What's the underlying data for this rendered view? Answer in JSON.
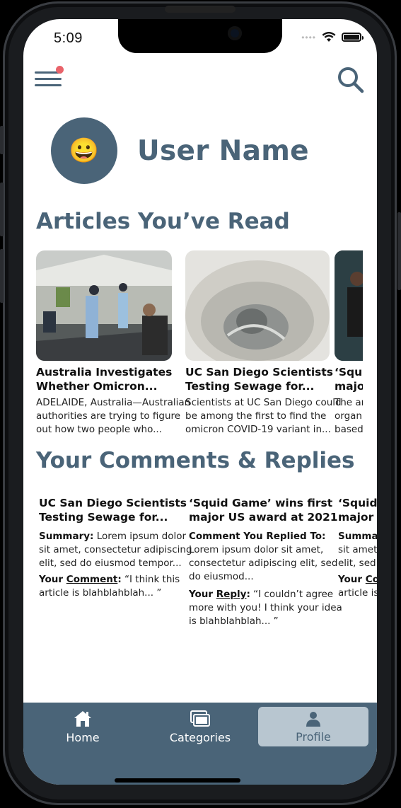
{
  "status": {
    "time": "5:09"
  },
  "profile": {
    "user_name": "User Name",
    "avatar_emoji": "😀"
  },
  "sections": {
    "articles_title": "Articles You’ve Read",
    "comments_title": "Your Comments & Replies"
  },
  "articles": [
    {
      "title1": "Australia Investigates",
      "title2": "Whether Omicron...",
      "s1": "ADELAIDE, Australia—Australian",
      "s2": "authorities are trying to figure",
      "s3": "out how two people who..."
    },
    {
      "title1": "UC San Diego Scientists",
      "title2": "Testing Sewage for...",
      "s1": "Scientists at UC San Diego could",
      "s2": "be among the first to find the",
      "s3": "omicron COVID-19 variant in..."
    },
    {
      "title1": "‘Squid Game’",
      "title2": "major US award",
      "s1": "The article on",
      "s2": "organization",
      "s3": "based..."
    }
  ],
  "comments": [
    {
      "title1": "UC San Diego Scientists",
      "title2": "Testing Sewage for...",
      "summary_label": "Summary:",
      "summary_l1": " Lorem ipsum dolor",
      "summary_l2": "sit amet, consectetur adipiscing",
      "summary_l3": "elit, sed do eiusmod tempor...",
      "your_label": "Your ",
      "your_ul": "Comment",
      "your_colon": ":",
      "your_l1": " “I think this",
      "your_l2": "article is blahblahblah... ”"
    },
    {
      "title1": "‘Squid Game’ wins first",
      "title2": "major US award at 2021",
      "replied_label": "Comment You Replied To:",
      "replied_l1": "Lorem ipsum dolor sit amet,",
      "replied_l2": "consectetur adipiscing elit, sed",
      "replied_l3": "do eiusmod...",
      "your_label": "Your ",
      "your_ul": "Reply",
      "your_colon": ":",
      "your_l1": " “I couldn’t agree",
      "your_l2": "more with you! I think your idea",
      "your_l3": "is blahblahblah... ”"
    },
    {
      "title1": "‘Squid Game’",
      "title2": "major US award",
      "summary_label": "Summary:",
      "summary_l1": "",
      "summary_l2": "sit amet",
      "summary_l3": "elit, sed",
      "your_label": "Your ",
      "your_ul": "Comment",
      "your_colon": ":",
      "your_l1": "",
      "your_l2": "article is..."
    }
  ],
  "tabs": {
    "home": "Home",
    "categories": "Categories",
    "profile": "Profile",
    "active": "profile"
  },
  "icons": {
    "menu": "hamburger-menu-icon",
    "search": "search-icon",
    "home": "home-icon",
    "categories": "categories-icon",
    "profile": "profile-icon"
  },
  "colors": {
    "primary": "#4a6478",
    "notification_dot": "#e9636a",
    "active_tab_bg": "#b8c6d0"
  }
}
